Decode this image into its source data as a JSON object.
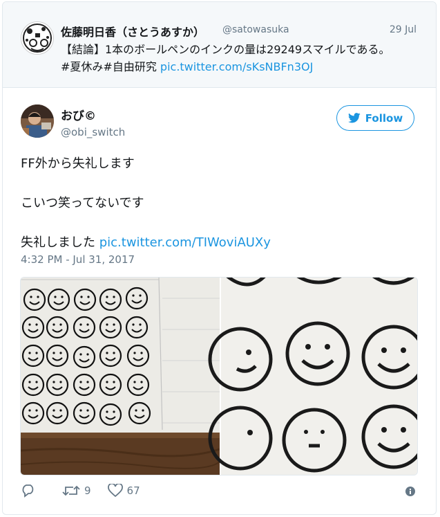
{
  "quoted": {
    "name": "佐藤明日香（さとうあすか）",
    "handle": "@satowasuka",
    "date": "29 Jul",
    "text_main": "【結論】1本のボールペンのインクの量は29249スマイルである。",
    "hashtags": "#夏休み#自由研究",
    "link": "pic.twitter.com/sKsNBFn3OJ"
  },
  "tweet": {
    "name": "おび©",
    "handle": "@obi_switch",
    "follow_label": "Follow",
    "line1": "FF外から失礼します",
    "line2": "こいつ笑ってないです",
    "line3": "失礼しました",
    "link": "pic.twitter.com/TIWoviAUXy",
    "timestamp": "4:32 PM - Jul 31, 2017"
  },
  "actions": {
    "retweets": "9",
    "likes": "67"
  },
  "colors": {
    "accent": "#1b95e0",
    "muted": "#657786"
  }
}
